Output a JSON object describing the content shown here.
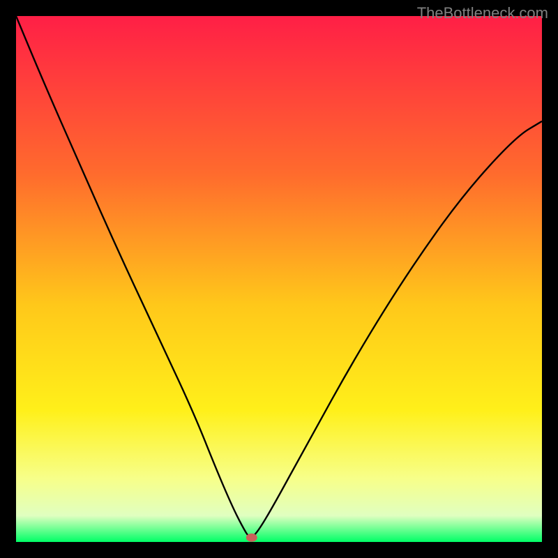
{
  "watermark": "TheBottleneck.com",
  "chart_data": {
    "type": "line",
    "title": "",
    "xlabel": "",
    "ylabel": "",
    "xrange": [
      0,
      1
    ],
    "yrange": [
      0,
      1
    ],
    "gradient_stops": [
      {
        "offset": 0.0,
        "color": "#ff1f46"
      },
      {
        "offset": 0.3,
        "color": "#ff6b2d"
      },
      {
        "offset": 0.55,
        "color": "#ffc81a"
      },
      {
        "offset": 0.75,
        "color": "#fff01a"
      },
      {
        "offset": 0.88,
        "color": "#f7ff8a"
      },
      {
        "offset": 0.95,
        "color": "#e0ffc0"
      },
      {
        "offset": 1.0,
        "color": "#00ff66"
      }
    ],
    "curve": {
      "comment": "V-shaped curve, steep left descent, shallower right ascent; minimum near x≈0.45, tiny red marker at floor",
      "x": [
        0.0,
        0.05,
        0.12,
        0.2,
        0.28,
        0.34,
        0.38,
        0.41,
        0.43,
        0.445,
        0.46,
        0.49,
        0.55,
        0.65,
        0.75,
        0.85,
        0.95,
        1.0
      ],
      "y": [
        1.0,
        0.88,
        0.72,
        0.54,
        0.37,
        0.24,
        0.14,
        0.07,
        0.03,
        0.005,
        0.02,
        0.07,
        0.18,
        0.36,
        0.52,
        0.66,
        0.77,
        0.8
      ]
    },
    "marker": {
      "x": 0.448,
      "y": 0.003,
      "color": "#c9615a"
    }
  }
}
